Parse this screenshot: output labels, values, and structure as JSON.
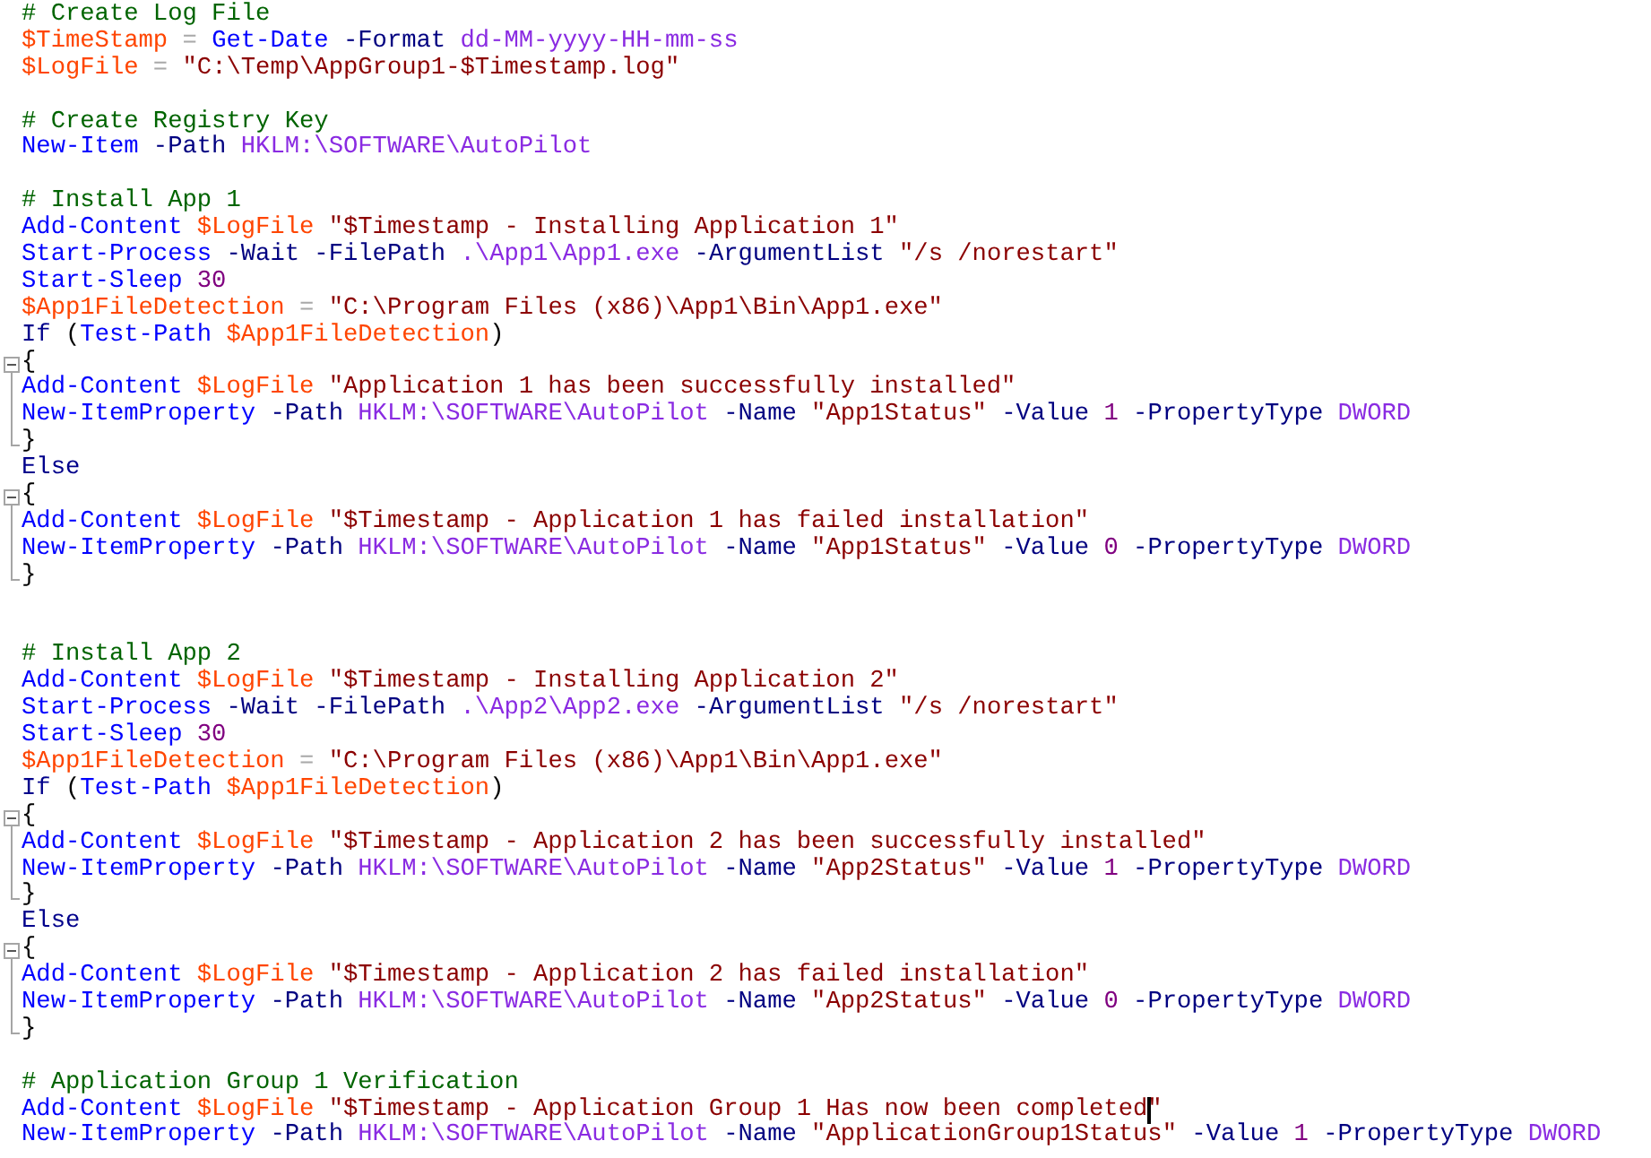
{
  "editor": {
    "lines": [
      {
        "kind": "code",
        "tokens": [
          {
            "kind": "comment",
            "text": "# Create Log File"
          }
        ]
      },
      {
        "kind": "code",
        "tokens": [
          {
            "kind": "variable",
            "text": "$TimeStamp"
          },
          {
            "kind": "operator",
            "text": " ="
          },
          {
            "kind": "command",
            "text": " Get-Date"
          },
          {
            "kind": "parameter",
            "text": " -Format"
          },
          {
            "kind": "argument",
            "text": " dd-MM-yyyy-HH-mm-ss"
          }
        ]
      },
      {
        "kind": "code",
        "tokens": [
          {
            "kind": "variable",
            "text": "$LogFile"
          },
          {
            "kind": "operator",
            "text": " ="
          },
          {
            "kind": "string",
            "text": " \"C:\\Temp\\AppGroup1-$Timestamp.log\""
          }
        ]
      },
      {
        "kind": "blank"
      },
      {
        "kind": "code",
        "tokens": [
          {
            "kind": "comment",
            "text": "# Create Registry Key"
          }
        ]
      },
      {
        "kind": "code",
        "tokens": [
          {
            "kind": "command",
            "text": "New-Item"
          },
          {
            "kind": "parameter",
            "text": " -Path"
          },
          {
            "kind": "argument",
            "text": " HKLM:\\SOFTWARE\\AutoPilot"
          }
        ]
      },
      {
        "kind": "blank"
      },
      {
        "kind": "code",
        "tokens": [
          {
            "kind": "comment",
            "text": "# Install App 1"
          }
        ]
      },
      {
        "kind": "code",
        "tokens": [
          {
            "kind": "command",
            "text": "Add-Content"
          },
          {
            "kind": "variable",
            "text": " $LogFile"
          },
          {
            "kind": "string",
            "text": " \"$Timestamp - Installing Application 1\""
          }
        ]
      },
      {
        "kind": "code",
        "tokens": [
          {
            "kind": "command",
            "text": "Start-Process"
          },
          {
            "kind": "parameter",
            "text": " -Wait"
          },
          {
            "kind": "parameter",
            "text": " -FilePath"
          },
          {
            "kind": "argument",
            "text": " .\\App1\\App1.exe"
          },
          {
            "kind": "parameter",
            "text": " -ArgumentList"
          },
          {
            "kind": "string",
            "text": " \"/s /norestart\""
          }
        ]
      },
      {
        "kind": "code",
        "tokens": [
          {
            "kind": "command",
            "text": "Start-Sleep"
          },
          {
            "kind": "number",
            "text": " 30"
          }
        ]
      },
      {
        "kind": "code",
        "tokens": [
          {
            "kind": "variable",
            "text": "$App1FileDetection"
          },
          {
            "kind": "operator",
            "text": " ="
          },
          {
            "kind": "string",
            "text": " \"C:\\Program Files (x86)\\App1\\Bin\\App1.exe\""
          }
        ]
      },
      {
        "kind": "code",
        "tokens": [
          {
            "kind": "keyword",
            "text": "If"
          },
          {
            "kind": "group",
            "text": " ("
          },
          {
            "kind": "command",
            "text": "Test-Path"
          },
          {
            "kind": "variable",
            "text": " $App1FileDetection"
          },
          {
            "kind": "group",
            "text": ")"
          }
        ]
      },
      {
        "kind": "code",
        "fold_start": true,
        "tokens": [
          {
            "kind": "group",
            "text": "{"
          }
        ]
      },
      {
        "kind": "code",
        "in_block": true,
        "tokens": [
          {
            "kind": "command",
            "text": "Add-Content"
          },
          {
            "kind": "variable",
            "text": " $LogFile"
          },
          {
            "kind": "string",
            "text": " \"Application 1 has been successfully installed\""
          }
        ]
      },
      {
        "kind": "code",
        "in_block": true,
        "tokens": [
          {
            "kind": "command",
            "text": "New-ItemProperty"
          },
          {
            "kind": "parameter",
            "text": " -Path"
          },
          {
            "kind": "argument",
            "text": " HKLM:\\SOFTWARE\\AutoPilot"
          },
          {
            "kind": "parameter",
            "text": " -Name"
          },
          {
            "kind": "string",
            "text": " \"App1Status\""
          },
          {
            "kind": "parameter",
            "text": " -Value"
          },
          {
            "kind": "number",
            "text": " 1"
          },
          {
            "kind": "parameter",
            "text": " -PropertyType"
          },
          {
            "kind": "argument",
            "text": " DWORD"
          }
        ]
      },
      {
        "kind": "code",
        "block_end": true,
        "tokens": [
          {
            "kind": "group",
            "text": "}"
          }
        ]
      },
      {
        "kind": "code",
        "tokens": [
          {
            "kind": "keyword",
            "text": "Else"
          }
        ]
      },
      {
        "kind": "code",
        "fold_start": true,
        "tokens": [
          {
            "kind": "group",
            "text": "{"
          }
        ]
      },
      {
        "kind": "code",
        "in_block": true,
        "tokens": [
          {
            "kind": "command",
            "text": "Add-Content"
          },
          {
            "kind": "variable",
            "text": " $LogFile"
          },
          {
            "kind": "string",
            "text": " \"$Timestamp - Application 1 has failed installation\""
          }
        ]
      },
      {
        "kind": "code",
        "in_block": true,
        "tokens": [
          {
            "kind": "command",
            "text": "New-ItemProperty"
          },
          {
            "kind": "parameter",
            "text": " -Path"
          },
          {
            "kind": "argument",
            "text": " HKLM:\\SOFTWARE\\AutoPilot"
          },
          {
            "kind": "parameter",
            "text": " -Name"
          },
          {
            "kind": "string",
            "text": " \"App1Status\""
          },
          {
            "kind": "parameter",
            "text": " -Value"
          },
          {
            "kind": "number",
            "text": " 0"
          },
          {
            "kind": "parameter",
            "text": " -PropertyType"
          },
          {
            "kind": "argument",
            "text": " DWORD"
          }
        ]
      },
      {
        "kind": "code",
        "block_end": true,
        "tokens": [
          {
            "kind": "group",
            "text": "}"
          }
        ]
      },
      {
        "kind": "blank"
      },
      {
        "kind": "blank"
      },
      {
        "kind": "code",
        "tokens": [
          {
            "kind": "comment",
            "text": "# Install App 2"
          }
        ]
      },
      {
        "kind": "code",
        "tokens": [
          {
            "kind": "command",
            "text": "Add-Content"
          },
          {
            "kind": "variable",
            "text": " $LogFile"
          },
          {
            "kind": "string",
            "text": " \"$Timestamp - Installing Application 2\""
          }
        ]
      },
      {
        "kind": "code",
        "tokens": [
          {
            "kind": "command",
            "text": "Start-Process"
          },
          {
            "kind": "parameter",
            "text": " -Wait"
          },
          {
            "kind": "parameter",
            "text": " -FilePath"
          },
          {
            "kind": "argument",
            "text": " .\\App2\\App2.exe"
          },
          {
            "kind": "parameter",
            "text": " -ArgumentList"
          },
          {
            "kind": "string",
            "text": " \"/s /norestart\""
          }
        ]
      },
      {
        "kind": "code",
        "tokens": [
          {
            "kind": "command",
            "text": "Start-Sleep"
          },
          {
            "kind": "number",
            "text": " 30"
          }
        ]
      },
      {
        "kind": "code",
        "tokens": [
          {
            "kind": "variable",
            "text": "$App1FileDetection"
          },
          {
            "kind": "operator",
            "text": " ="
          },
          {
            "kind": "string",
            "text": " \"C:\\Program Files (x86)\\App1\\Bin\\App1.exe\""
          }
        ]
      },
      {
        "kind": "code",
        "tokens": [
          {
            "kind": "keyword",
            "text": "If"
          },
          {
            "kind": "group",
            "text": " ("
          },
          {
            "kind": "command",
            "text": "Test-Path"
          },
          {
            "kind": "variable",
            "text": " $App1FileDetection"
          },
          {
            "kind": "group",
            "text": ")"
          }
        ]
      },
      {
        "kind": "code",
        "fold_start": true,
        "tokens": [
          {
            "kind": "group",
            "text": "{"
          }
        ]
      },
      {
        "kind": "code",
        "in_block": true,
        "tokens": [
          {
            "kind": "command",
            "text": "Add-Content"
          },
          {
            "kind": "variable",
            "text": " $LogFile"
          },
          {
            "kind": "string",
            "text": " \"$Timestamp - Application 2 has been successfully installed\""
          }
        ]
      },
      {
        "kind": "code",
        "in_block": true,
        "tokens": [
          {
            "kind": "command",
            "text": "New-ItemProperty"
          },
          {
            "kind": "parameter",
            "text": " -Path"
          },
          {
            "kind": "argument",
            "text": " HKLM:\\SOFTWARE\\AutoPilot"
          },
          {
            "kind": "parameter",
            "text": " -Name"
          },
          {
            "kind": "string",
            "text": " \"App2Status\""
          },
          {
            "kind": "parameter",
            "text": " -Value"
          },
          {
            "kind": "number",
            "text": " 1"
          },
          {
            "kind": "parameter",
            "text": " -PropertyType"
          },
          {
            "kind": "argument",
            "text": " DWORD"
          }
        ]
      },
      {
        "kind": "code",
        "block_end": true,
        "tokens": [
          {
            "kind": "group",
            "text": "}"
          }
        ]
      },
      {
        "kind": "code",
        "tokens": [
          {
            "kind": "keyword",
            "text": "Else"
          }
        ]
      },
      {
        "kind": "code",
        "fold_start": true,
        "tokens": [
          {
            "kind": "group",
            "text": "{"
          }
        ]
      },
      {
        "kind": "code",
        "in_block": true,
        "tokens": [
          {
            "kind": "command",
            "text": "Add-Content"
          },
          {
            "kind": "variable",
            "text": " $LogFile"
          },
          {
            "kind": "string",
            "text": " \"$Timestamp - Application 2 has failed installation\""
          }
        ]
      },
      {
        "kind": "code",
        "in_block": true,
        "tokens": [
          {
            "kind": "command",
            "text": "New-ItemProperty"
          },
          {
            "kind": "parameter",
            "text": " -Path"
          },
          {
            "kind": "argument",
            "text": " HKLM:\\SOFTWARE\\AutoPilot"
          },
          {
            "kind": "parameter",
            "text": " -Name"
          },
          {
            "kind": "string",
            "text": " \"App2Status\""
          },
          {
            "kind": "parameter",
            "text": " -Value"
          },
          {
            "kind": "number",
            "text": " 0"
          },
          {
            "kind": "parameter",
            "text": " -PropertyType"
          },
          {
            "kind": "argument",
            "text": " DWORD"
          }
        ]
      },
      {
        "kind": "code",
        "block_end": true,
        "tokens": [
          {
            "kind": "group",
            "text": "}"
          }
        ]
      },
      {
        "kind": "blank"
      },
      {
        "kind": "code",
        "tokens": [
          {
            "kind": "comment",
            "text": "# Application Group 1 Verification"
          }
        ]
      },
      {
        "kind": "code",
        "tokens": [
          {
            "kind": "command",
            "text": "Add-Content"
          },
          {
            "kind": "variable",
            "text": " $LogFile"
          },
          {
            "kind": "string",
            "text": " \"$Timestamp - Application Group 1 Has now been completed"
          },
          {
            "kind": "string",
            "text": "\"",
            "caret_before": true
          }
        ]
      },
      {
        "kind": "code",
        "tokens": [
          {
            "kind": "command",
            "text": "New-ItemProperty"
          },
          {
            "kind": "parameter",
            "text": " -Path"
          },
          {
            "kind": "argument",
            "text": " HKLM:\\SOFTWARE\\AutoPilot"
          },
          {
            "kind": "parameter",
            "text": " -Name"
          },
          {
            "kind": "string",
            "text": " \"ApplicationGroup1Status\""
          },
          {
            "kind": "parameter",
            "text": " -Value"
          },
          {
            "kind": "number",
            "text": " 1"
          },
          {
            "kind": "parameter",
            "text": " -PropertyType"
          },
          {
            "kind": "argument",
            "text": " DWORD"
          }
        ]
      }
    ]
  }
}
